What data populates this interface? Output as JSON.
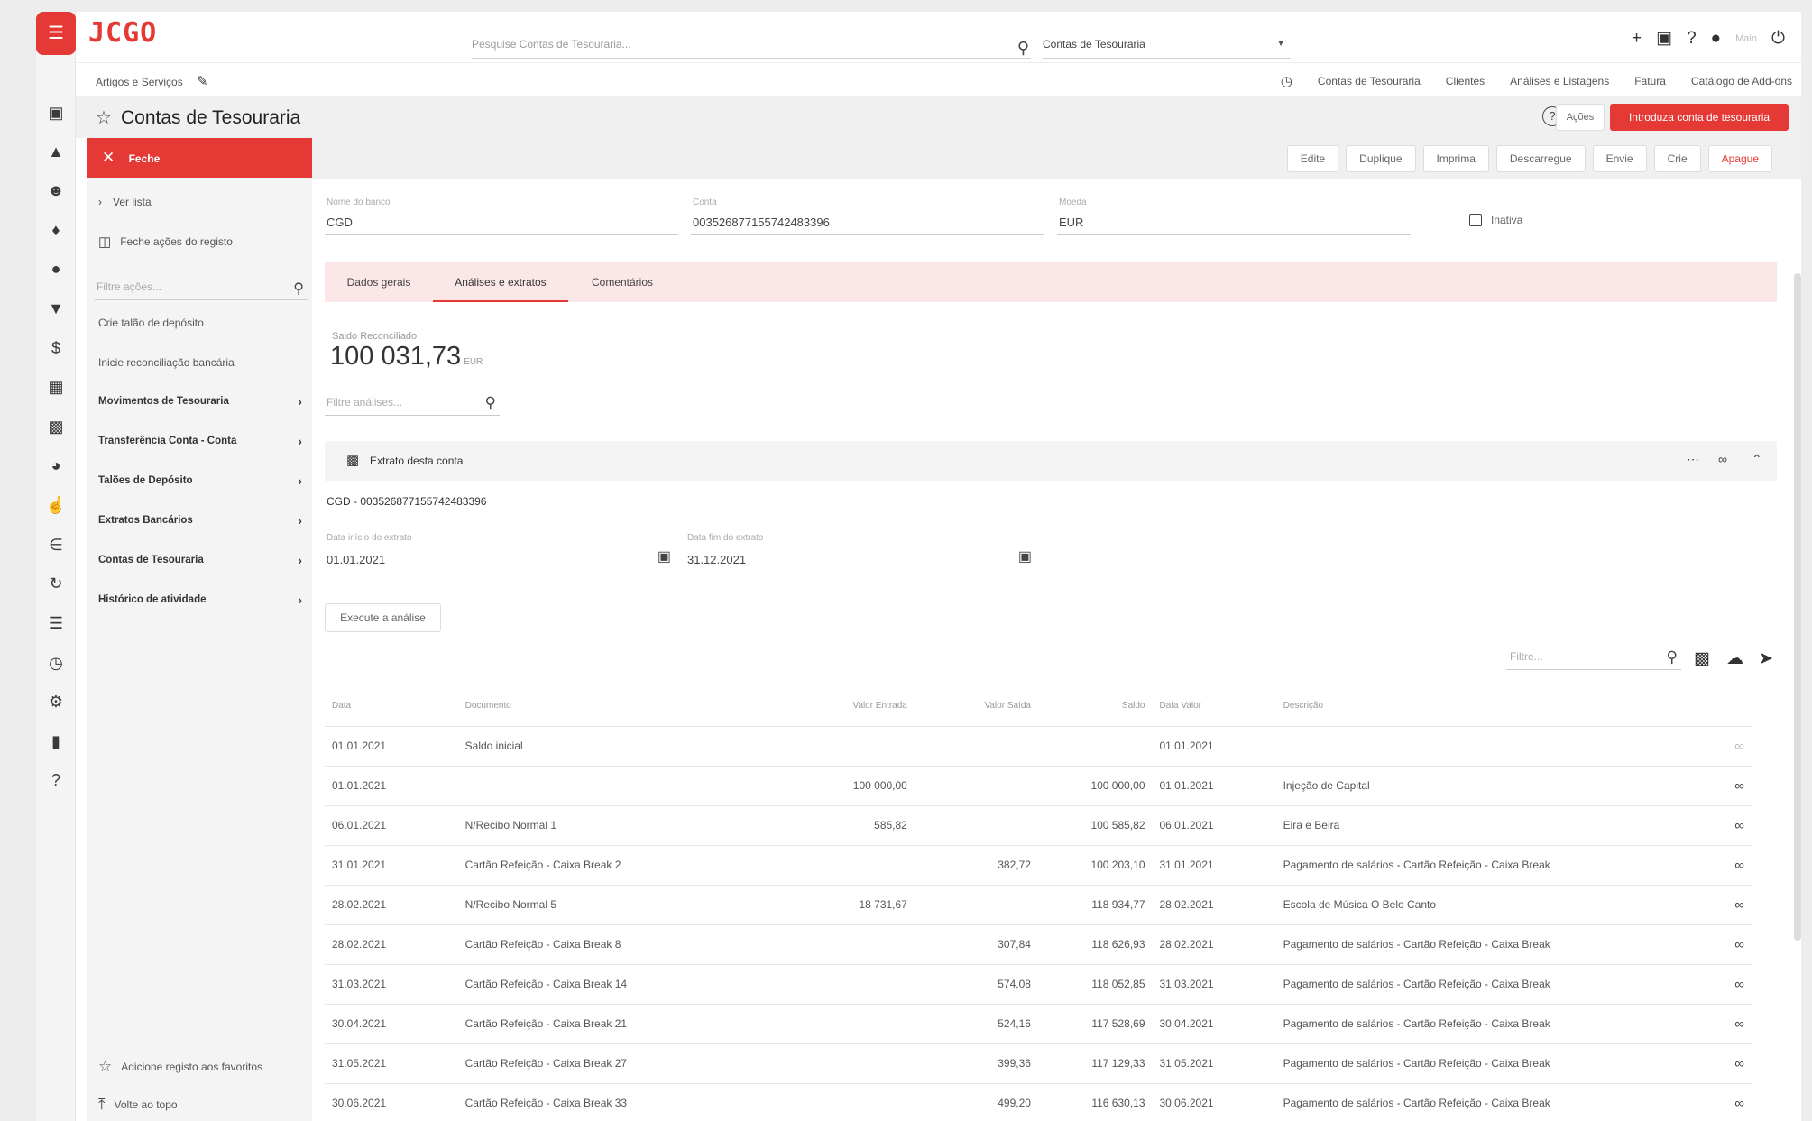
{
  "header": {
    "logo": "JCGO",
    "search_placeholder": "Pesquise Contas de Tesouraria...",
    "scope": "Contas de Tesouraria",
    "user_name": "Main"
  },
  "subbar": {
    "crumb": "Artigos e Serviços",
    "links": [
      "Contas de Tesouraria",
      "Clientes",
      "Análises e Listagens",
      "Fatura",
      "Catálogo de Add-ons"
    ]
  },
  "page": {
    "title": "Contas de Tesouraria",
    "actions_label": "Ações",
    "primary_label": "Introduza conta de tesouraria"
  },
  "left_panel": {
    "close_label": "Feche",
    "items": [
      "Ver lista",
      "Feche ações do registo"
    ],
    "filter_placeholder": "Filtre ações...",
    "actions": [
      "Crie talão de depósito",
      "Inicie reconciliação bancária"
    ],
    "groups": [
      "Movimentos de Tesouraria",
      "Transferência Conta - Conta",
      "Talões de Depósito",
      "Extratos Bancários",
      "Contas de Tesouraria",
      "Histórico de atividade"
    ],
    "bottom": [
      "Adicione registo aos favoritos",
      "Volte ao topo"
    ]
  },
  "toolbar": {
    "buttons": [
      "Edite",
      "Duplique",
      "Imprima",
      "Descarregue",
      "Envie",
      "Crie",
      "Apague"
    ]
  },
  "record": {
    "bank_label": "Nome do banco",
    "bank": "CGD",
    "account_label": "Conta",
    "account": "003526877155742483396",
    "currency_label": "Moeda",
    "currency": "EUR",
    "inactive_label": "Inativa"
  },
  "tabs": [
    "Dados gerais",
    "Análises e extratos",
    "Comentários"
  ],
  "balance": {
    "label": "Saldo Reconciliado",
    "value": "100 031,73",
    "unit": "EUR"
  },
  "analyses_filter_placeholder": "Filtre análises...",
  "statement": {
    "title": "Extrato desta conta",
    "account_line": "CGD - 003526877155742483396",
    "start_label": "Data início do extrato",
    "start": "01.01.2021",
    "end_label": "Data fim do extrato",
    "end": "31.12.2021",
    "run_label": "Execute a análise",
    "filter_placeholder": "Filtre..."
  },
  "table": {
    "headers": [
      "Data",
      "Documento",
      "Valor Entrada",
      "Valor Saída",
      "Saldo",
      "Data Valor",
      "Descrição"
    ],
    "rows": [
      [
        "01.01.2021",
        "Saldo inicial",
        "",
        "",
        "",
        "01.01.2021",
        ""
      ],
      [
        "01.01.2021",
        "",
        "100 000,00",
        "",
        "100 000,00",
        "01.01.2021",
        "Injeção de Capital"
      ],
      [
        "06.01.2021",
        "N/Recibo Normal 1",
        "585,82",
        "",
        "100 585,82",
        "06.01.2021",
        "Eira e Beira"
      ],
      [
        "31.01.2021",
        "Cartão Refeição - Caixa Break 2",
        "",
        "382,72",
        "100 203,10",
        "31.01.2021",
        "Pagamento de salários - Cartão Refeição - Caixa Break"
      ],
      [
        "28.02.2021",
        "N/Recibo Normal 5",
        "18 731,67",
        "",
        "118 934,77",
        "28.02.2021",
        "Escola de Música O Belo Canto"
      ],
      [
        "28.02.2021",
        "Cartão Refeição - Caixa Break 8",
        "",
        "307,84",
        "118 626,93",
        "28.02.2021",
        "Pagamento de salários - Cartão Refeição - Caixa Break"
      ],
      [
        "31.03.2021",
        "Cartão Refeição - Caixa Break 14",
        "",
        "574,08",
        "118 052,85",
        "31.03.2021",
        "Pagamento de salários - Cartão Refeição - Caixa Break"
      ],
      [
        "30.04.2021",
        "Cartão Refeição - Caixa Break 21",
        "",
        "524,16",
        "117 528,69",
        "30.04.2021",
        "Pagamento de salários - Cartão Refeição - Caixa Break"
      ],
      [
        "31.05.2021",
        "Cartão Refeição - Caixa Break 27",
        "",
        "399,36",
        "117 129,33",
        "31.05.2021",
        "Pagamento de salários - Cartão Refeição - Caixa Break"
      ],
      [
        "30.06.2021",
        "Cartão Refeição - Caixa Break 33",
        "",
        "499,20",
        "116 630,13",
        "30.06.2021",
        "Pagamento de salários - Cartão Refeição - Caixa Break"
      ]
    ]
  }
}
